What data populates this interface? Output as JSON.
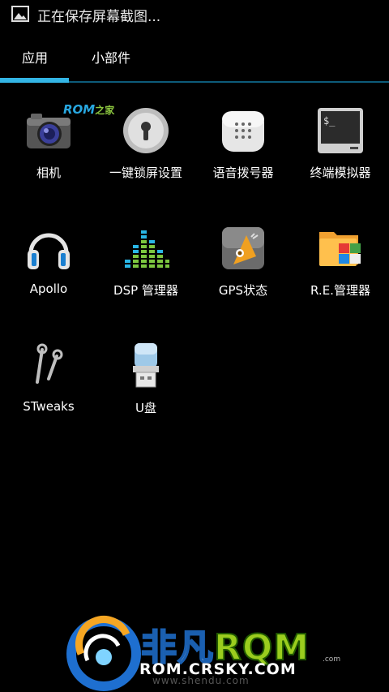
{
  "statusbar": {
    "notification_text": "正在保存屏幕截图...",
    "icon": "image-icon"
  },
  "tabs": [
    {
      "label": "应用",
      "selected": true
    },
    {
      "label": "小部件",
      "selected": false
    }
  ],
  "colors": {
    "accent": "#33b5e5",
    "background": "#000000"
  },
  "rom_tag": {
    "rom": "ROM",
    "zhijia": "之家"
  },
  "apps": [
    {
      "label": "相机",
      "icon": "camera-icon"
    },
    {
      "label": "一键锁屏设置",
      "icon": "lock-icon"
    },
    {
      "label": "语音拨号器",
      "icon": "voice-dialer-icon"
    },
    {
      "label": "终端模拟器",
      "icon": "terminal-icon"
    },
    {
      "label": "Apollo",
      "icon": "headphones-icon"
    },
    {
      "label": "DSP 管理器",
      "icon": "equalizer-icon"
    },
    {
      "label": "GPS状态",
      "icon": "gps-icon"
    },
    {
      "label": "R.E.管理器",
      "icon": "folder-icon"
    },
    {
      "label": "STweaks",
      "icon": "wrench-icon"
    },
    {
      "label": "U盘",
      "icon": "usb-drive-icon"
    }
  ],
  "watermark": {
    "title_cn": "非凡",
    "title_rom": "RQM",
    "domain": "ROM.CRSKY.COM",
    "com_small": ".com",
    "sub": "www.shendu.com"
  }
}
